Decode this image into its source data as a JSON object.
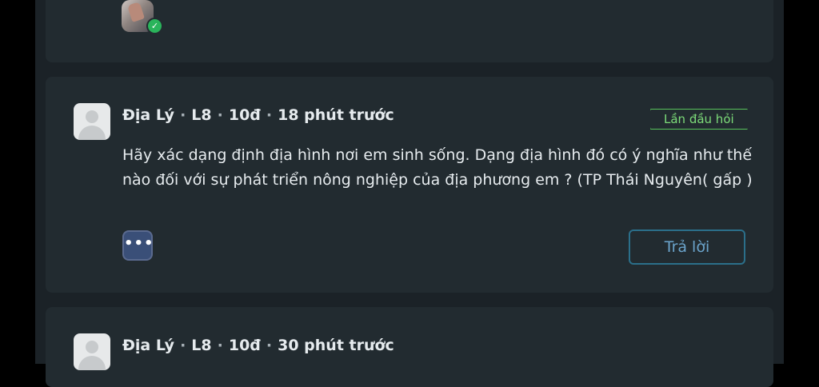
{
  "posts": [
    {
      "subject": "Địa Lý",
      "grade": "L8",
      "points": "10đ",
      "time": "18 phút trước",
      "badge": "Lần đầu hỏi",
      "question": "Hãy xác dạng định địa hình nơi em sinh sống. Dạng địa hình đó có ý nghĩa như thế nào đối với sự phát triển nông nghiệp của địa phương em ? (TP Thái Nguyên( gấp )",
      "more_label": "•••",
      "reply_label": "Trả lời"
    },
    {
      "subject": "Địa Lý",
      "grade": "L8",
      "points": "10đ",
      "time": "30 phút trước"
    }
  ],
  "colors": {
    "background": "#1b2227",
    "card": "#222b30",
    "badge": "#58c35b",
    "reply_border": "#2b6f8a",
    "verified": "#2ab45b"
  },
  "icons": {
    "verified": "check-icon",
    "more": "ellipsis-icon"
  }
}
